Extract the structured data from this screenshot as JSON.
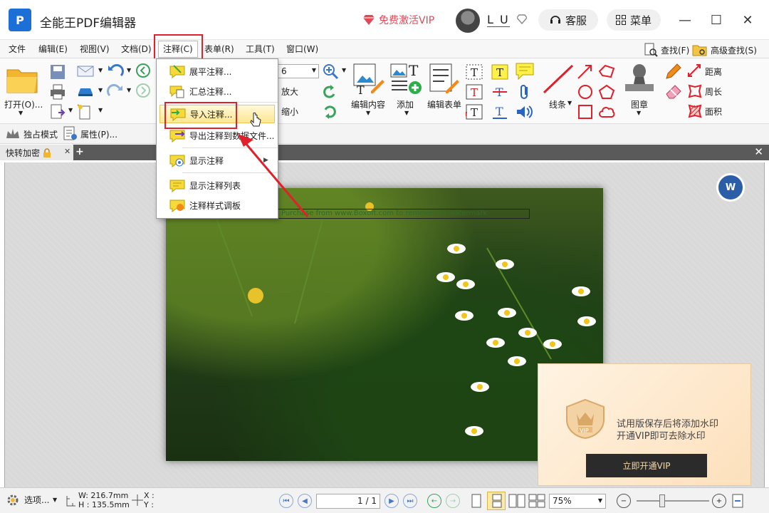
{
  "app": {
    "logo": "P",
    "title": "全能王PDF编辑器"
  },
  "header": {
    "vip_label": "免费激活VIP",
    "user_name": "L U",
    "service_label": "客服",
    "menu_label": "菜单"
  },
  "menubar": {
    "items": [
      "文件",
      "编辑(E)",
      "视图(V)",
      "文档(D)",
      "注释(C)",
      "表单(R)",
      "工具(T)",
      "窗口(W)"
    ],
    "find": "查找(F)",
    "advanced_find": "高级查找(S)"
  },
  "ribbon": {
    "open": "打开(O)...",
    "zoom_value": "6",
    "zoom_in": "放大",
    "zoom_out": "缩小",
    "edit_content": "编辑内容",
    "add": "添加",
    "edit_form": "编辑表单",
    "line": "线条",
    "stamp": "图章",
    "distance": "距离",
    "perimeter": "周长",
    "area": "面积",
    "exclusive_mode": "独占模式",
    "properties": "属性(P)..."
  },
  "tabs": {
    "doc_tab": "快转加密"
  },
  "dropdown": {
    "items": [
      {
        "label": "展平注释..."
      },
      {
        "label": "汇总注释..."
      },
      {
        "label": "导入注释..."
      },
      {
        "label": "导出注释到数据文件..."
      },
      {
        "label": "显示注释"
      },
      {
        "label": "显示注释列表"
      },
      {
        "label": "注释样式调板"
      }
    ]
  },
  "document": {
    "watermark": "Purchase from www.Boxoft.com to remove the watermark"
  },
  "vip_popup": {
    "line1": "试用版保存后将添加水印",
    "line2": "开通VIP即可去除水印",
    "button": "立即开通VIP",
    "emblem": "VIP"
  },
  "statusbar": {
    "options": "选项...",
    "width": "W: 216.7mm",
    "height": "H : 135.5mm",
    "x": "X :",
    "y": "Y :",
    "page": "1 / 1",
    "zoom": "75%"
  }
}
